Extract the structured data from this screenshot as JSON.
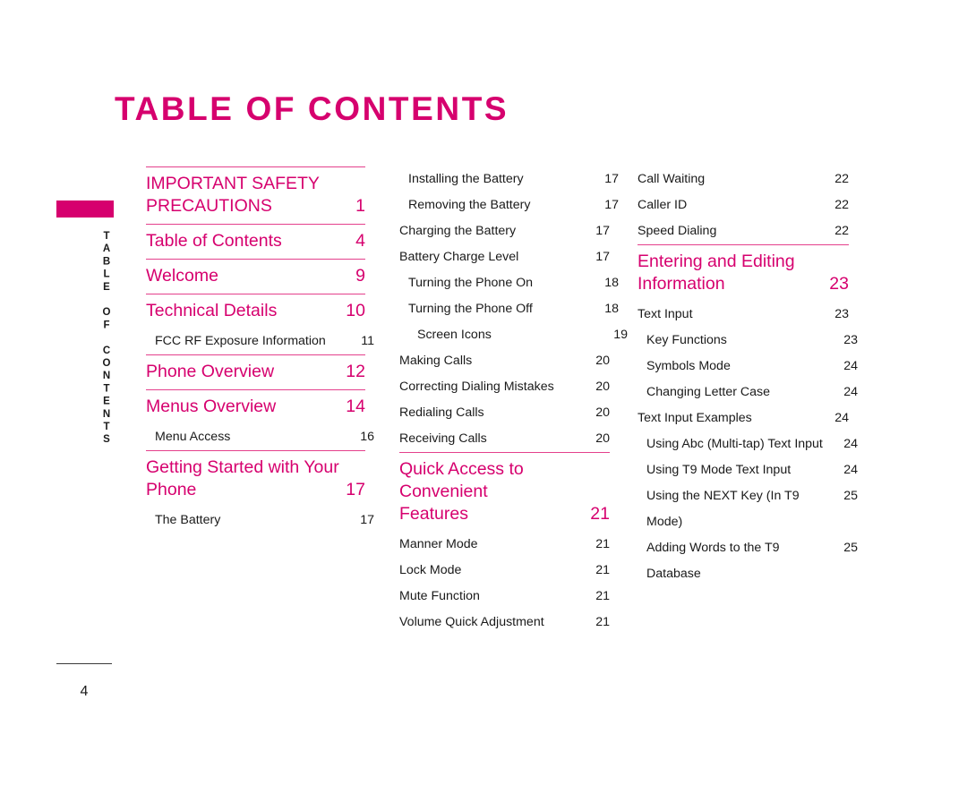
{
  "document": {
    "title": "TABLE OF CONTENTS",
    "side_tab_label": "TABLE OF CONTENTS",
    "page_number": "4",
    "accent_color": "#D6006E",
    "rule_color": "#E4408C",
    "text_color": "#1a1a1a"
  },
  "columns": [
    {
      "id": "column-1",
      "entries": [
        {
          "type": "rule"
        },
        {
          "type": "heading",
          "label": "IMPORTANT SAFETY\nPRECAUTIONS",
          "page": "1",
          "lines": 2
        },
        {
          "type": "rule"
        },
        {
          "type": "heading",
          "label": "Table of Contents",
          "page": "4",
          "lines": 1
        },
        {
          "type": "rule"
        },
        {
          "type": "heading",
          "label": "Welcome",
          "page": "9",
          "lines": 1
        },
        {
          "type": "rule"
        },
        {
          "type": "heading",
          "label": "Technical Details",
          "page": "10",
          "lines": 1
        },
        {
          "type": "sub",
          "label": "FCC RF Exposure Information",
          "page": "11",
          "indent": 1
        },
        {
          "type": "rule"
        },
        {
          "type": "heading",
          "label": "Phone Overview",
          "page": "12",
          "lines": 1
        },
        {
          "type": "rule"
        },
        {
          "type": "heading",
          "label": "Menus Overview",
          "page": "14",
          "lines": 1
        },
        {
          "type": "sub",
          "label": "Menu Access",
          "page": "16",
          "indent": 1
        },
        {
          "type": "rule"
        },
        {
          "type": "heading",
          "label": "Getting Started with Your\nPhone",
          "page": "17",
          "lines": 2
        },
        {
          "type": "sub",
          "label": "The Battery",
          "page": "17",
          "indent": 1
        }
      ]
    },
    {
      "id": "column-2",
      "entries": [
        {
          "type": "sub",
          "label": "Installing the Battery",
          "page": "17",
          "indent": 1
        },
        {
          "type": "sub",
          "label": "Removing the Battery",
          "page": "17",
          "indent": 1
        },
        {
          "type": "sub",
          "label": "Charging the Battery",
          "page": "17",
          "indent": 0
        },
        {
          "type": "sub",
          "label": "Battery Charge Level",
          "page": "17",
          "indent": 0
        },
        {
          "type": "sub",
          "label": "Turning the Phone On",
          "page": "18",
          "indent": 1
        },
        {
          "type": "sub",
          "label": "Turning the Phone Off",
          "page": "18",
          "indent": 1
        },
        {
          "type": "sub",
          "label": "Screen Icons",
          "page": "19",
          "indent": 2
        },
        {
          "type": "sub",
          "label": "Making Calls",
          "page": "20",
          "indent": 0
        },
        {
          "type": "sub",
          "label": "Correcting Dialing Mistakes",
          "page": "20",
          "indent": 0
        },
        {
          "type": "sub",
          "label": "Redialing Calls",
          "page": "20",
          "indent": 0
        },
        {
          "type": "sub",
          "label": "Receiving Calls",
          "page": "20",
          "indent": 0
        },
        {
          "type": "rule"
        },
        {
          "type": "heading",
          "label": "Quick Access to Convenient\nFeatures",
          "page": "21",
          "lines": 2
        },
        {
          "type": "sub",
          "label": "Manner Mode",
          "page": "21",
          "indent": 0
        },
        {
          "type": "sub",
          "label": "Lock Mode",
          "page": "21",
          "indent": 0
        },
        {
          "type": "sub",
          "label": "Mute Function",
          "page": "21",
          "indent": 0
        },
        {
          "type": "sub",
          "label": "Volume Quick Adjustment",
          "page": "21",
          "indent": 0
        }
      ]
    },
    {
      "id": "column-3",
      "entries": [
        {
          "type": "sub",
          "label": "Call Waiting",
          "page": "22",
          "indent": 0
        },
        {
          "type": "sub",
          "label": "Caller ID",
          "page": "22",
          "indent": 0
        },
        {
          "type": "sub",
          "label": "Speed Dialing",
          "page": "22",
          "indent": 0
        },
        {
          "type": "rule"
        },
        {
          "type": "heading",
          "label": "Entering and Editing\nInformation",
          "page": "23",
          "lines": 2
        },
        {
          "type": "sub",
          "label": "Text Input",
          "page": "23",
          "indent": 0
        },
        {
          "type": "sub",
          "label": "Key Functions",
          "page": "23",
          "indent": 1
        },
        {
          "type": "sub",
          "label": "Symbols Mode",
          "page": "24",
          "indent": 1
        },
        {
          "type": "sub",
          "label": "Changing Letter Case",
          "page": "24",
          "indent": 1
        },
        {
          "type": "sub",
          "label": "Text Input Examples",
          "page": "24",
          "indent": 0
        },
        {
          "type": "sub",
          "label": "Using Abc (Multi-tap) Text Input",
          "page": "24",
          "indent": 1
        },
        {
          "type": "sub",
          "label": "Using T9 Mode Text Input",
          "page": "24",
          "indent": 1
        },
        {
          "type": "sub",
          "label": "Using the NEXT Key (In T9 Mode)",
          "page": "25",
          "indent": 1
        },
        {
          "type": "sub",
          "label": "Adding Words to the T9 Database",
          "page": "25",
          "indent": 1
        }
      ]
    }
  ]
}
